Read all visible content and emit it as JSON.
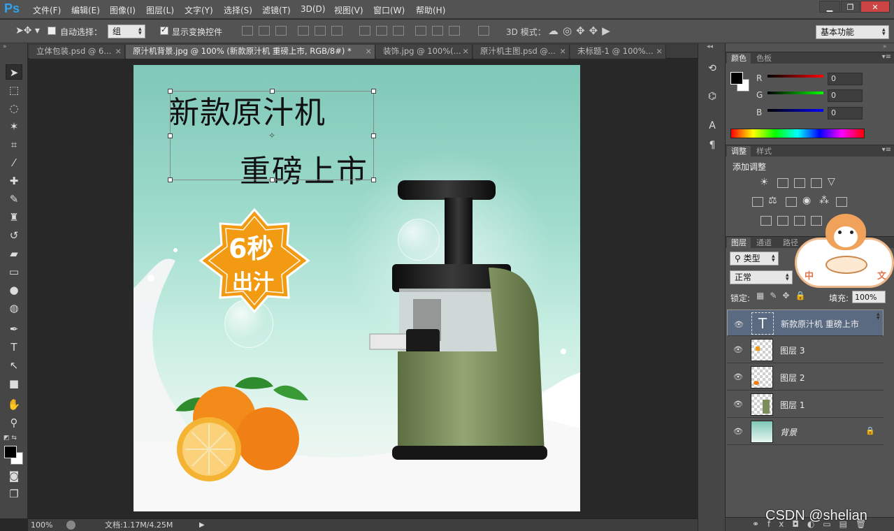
{
  "app": {
    "logo": "Ps"
  },
  "menu": [
    "文件(F)",
    "编辑(E)",
    "图像(I)",
    "图层(L)",
    "文字(Y)",
    "选择(S)",
    "滤镜(T)",
    "3D(D)",
    "视图(V)",
    "窗口(W)",
    "帮助(H)"
  ],
  "window_controls": {
    "minimize": "▁",
    "restore": "❐",
    "close": "✕"
  },
  "options": {
    "auto_select_label": "自动选择：",
    "auto_select_checked": false,
    "auto_select_value": "组",
    "show_transform_label": "显示变换控件",
    "show_transform_checked": true,
    "mode_3d_label": "3D 模式：",
    "workspace": "基本功能"
  },
  "tabs": [
    {
      "label": "立体包装.psd @ 6...",
      "active": false
    },
    {
      "label": "原汁机背景.jpg @ 100% (新款原汁机      重磅上市, RGB/8#) *",
      "active": true
    },
    {
      "label": "装饰.jpg @ 100%(...",
      "active": false
    },
    {
      "label": "原汁机主图.psd @...",
      "active": false
    },
    {
      "label": "未标题-1 @ 100%...",
      "active": false
    }
  ],
  "canvas": {
    "title_line1": "新款原汁机",
    "title_line2": "重磅上市",
    "badge_line1": "6秒",
    "badge_line2": "出汁",
    "colors": {
      "badge": "#f29a12",
      "juicer_body": "#7a8d5a",
      "bg_top": "#7fc7b8"
    }
  },
  "status": {
    "zoom": "100%",
    "doc_info": "文档:1.17M/4.25M"
  },
  "color_panel": {
    "tabs": [
      "颜色",
      "色板"
    ],
    "channels": [
      {
        "name": "R",
        "value": "0"
      },
      {
        "name": "G",
        "value": "0"
      },
      {
        "name": "B",
        "value": "0"
      }
    ]
  },
  "adjust_panel": {
    "tabs": [
      "调整",
      "样式"
    ],
    "title": "添加调整"
  },
  "layers_panel": {
    "tabs": [
      "图层",
      "通道",
      "路径"
    ],
    "filter_label": "类型",
    "blend_mode": "正常",
    "lock_label": "锁定:",
    "fill_label": "填充:",
    "fill_value": "100%",
    "layers": [
      {
        "name": "新款原汁机      重磅上市",
        "type": "text",
        "selected": true
      },
      {
        "name": "图层 3",
        "type": "image",
        "selected": false
      },
      {
        "name": "图层 2",
        "type": "image",
        "selected": false
      },
      {
        "name": "图层 1",
        "type": "image",
        "selected": false
      },
      {
        "name": "背景",
        "type": "background",
        "selected": false
      }
    ]
  },
  "sticker": {
    "left_char": "中",
    "right_char": "文"
  },
  "watermark": "CSDN @shelian"
}
